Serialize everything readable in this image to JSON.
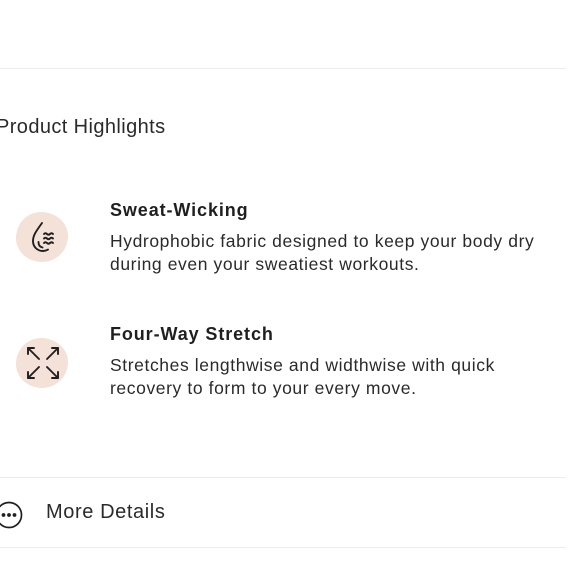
{
  "highlights": {
    "title": "Product Highlights",
    "items": [
      {
        "icon": "sweat-wicking-drop-icon",
        "title": "Sweat-Wicking",
        "description": "Hydrophobic fabric designed to keep your body dry during even your sweatiest workouts."
      },
      {
        "icon": "four-way-stretch-arrows-icon",
        "title": "Four-Way Stretch",
        "description": "Stretches lengthwise and widthwise with quick recovery to form to your every move."
      }
    ]
  },
  "more_details": {
    "label": "More Details",
    "icon": "more-dots-icon"
  },
  "colors": {
    "icon_background": "#f4e1d8",
    "text": "#1f1f1f",
    "divider": "#ececec"
  }
}
